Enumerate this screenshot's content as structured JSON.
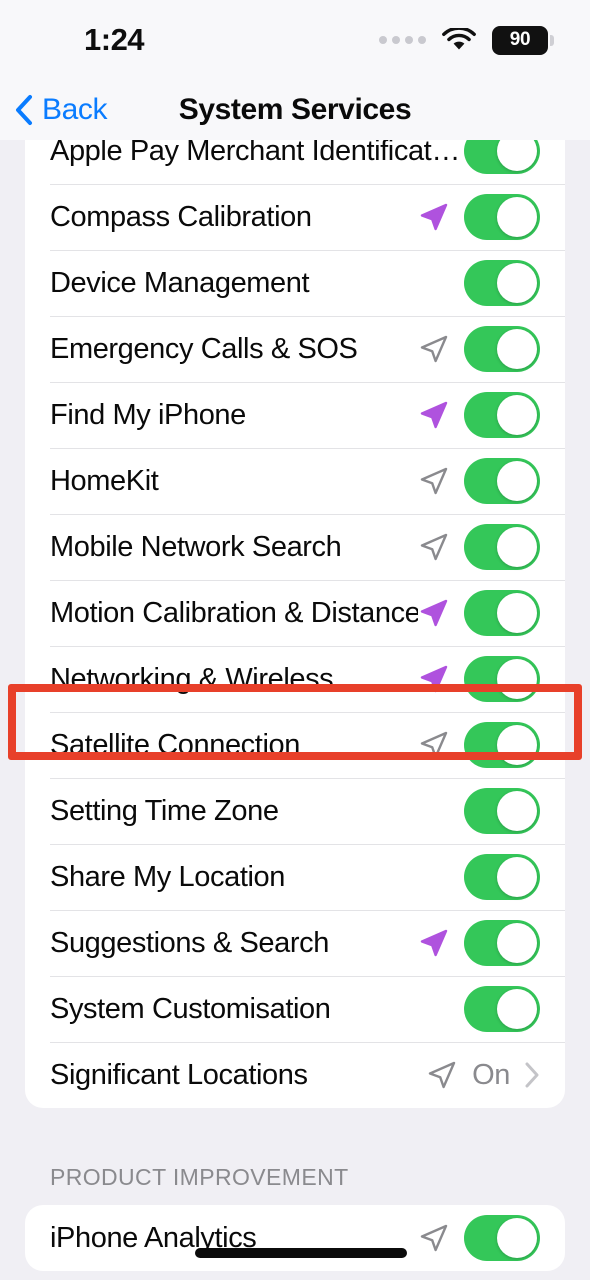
{
  "status_bar": {
    "time": "1:24",
    "battery_percent": "90",
    "signal_icon": "cellular-dots-icon",
    "wifi_icon": "wifi-icon",
    "battery_icon": "battery-icon"
  },
  "nav": {
    "back_label": "Back",
    "back_icon": "chevron-left-icon",
    "title": "System Services"
  },
  "colors": {
    "toggle_on": "#34C759",
    "accent_blue": "#0A7CFF",
    "arrow_purple": "#AF52DE",
    "arrow_gray": "#8A8A8E",
    "highlight_red": "#E8402A",
    "page_background": "#F0EFF4"
  },
  "sections": [
    {
      "header": "",
      "rows": [
        {
          "label": "Apple Pay Merchant Identificat…",
          "arrow": "none",
          "control": "toggle",
          "toggle_on": true
        },
        {
          "label": "Compass Calibration",
          "arrow": "purple",
          "control": "toggle",
          "toggle_on": true
        },
        {
          "label": "Device Management",
          "arrow": "none",
          "control": "toggle",
          "toggle_on": true
        },
        {
          "label": "Emergency Calls & SOS",
          "arrow": "gray",
          "control": "toggle",
          "toggle_on": true
        },
        {
          "label": "Find My iPhone",
          "arrow": "purple",
          "control": "toggle",
          "toggle_on": true
        },
        {
          "label": "HomeKit",
          "arrow": "gray",
          "control": "toggle",
          "toggle_on": true
        },
        {
          "label": "Mobile Network Search",
          "arrow": "gray",
          "control": "toggle",
          "toggle_on": true
        },
        {
          "label": "Motion Calibration & Distance",
          "arrow": "purple",
          "control": "toggle",
          "toggle_on": true
        },
        {
          "label": "Networking & Wireless",
          "arrow": "purple",
          "control": "toggle",
          "toggle_on": true,
          "highlighted": true
        },
        {
          "label": "Satellite Connection",
          "arrow": "gray",
          "control": "toggle",
          "toggle_on": true
        },
        {
          "label": "Setting Time Zone",
          "arrow": "none",
          "control": "toggle",
          "toggle_on": true
        },
        {
          "label": "Share My Location",
          "arrow": "none",
          "control": "toggle",
          "toggle_on": true
        },
        {
          "label": "Suggestions & Search",
          "arrow": "purple",
          "control": "toggle",
          "toggle_on": true
        },
        {
          "label": "System Customisation",
          "arrow": "none",
          "control": "toggle",
          "toggle_on": true
        },
        {
          "label": "Significant Locations",
          "arrow": "gray",
          "control": "disclosure",
          "value": "On",
          "chevron_icon": "chevron-right-icon"
        }
      ]
    },
    {
      "header": "PRODUCT IMPROVEMENT",
      "rows": [
        {
          "label": "iPhone Analytics",
          "arrow": "gray",
          "control": "toggle",
          "toggle_on": true
        }
      ]
    }
  ]
}
